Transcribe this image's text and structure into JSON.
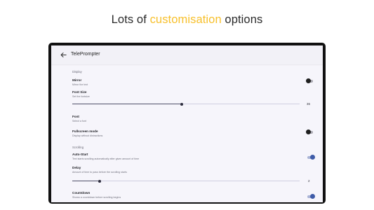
{
  "headline": {
    "prefix": "Lots of ",
    "highlight": "customisation",
    "suffix": " options",
    "highlight_color": "#f7c02c"
  },
  "app": {
    "title": "TelePrompter",
    "back_icon": "arrow-left-icon"
  },
  "sections": {
    "display": "Display",
    "scrolling": "Scrolling"
  },
  "settings": {
    "mirror": {
      "title": "Mirror",
      "subtitle": "Mirror the text",
      "enabled": false
    },
    "font_size": {
      "title": "Font Size",
      "subtitle": "Set the fontsize",
      "value": "36",
      "fraction": 0.48
    },
    "font": {
      "title": "Font",
      "subtitle": "Select a font"
    },
    "fullscreen": {
      "title": "Fullscreen mode",
      "subtitle": "Display without distractions",
      "enabled": false
    },
    "auto_start": {
      "title": "Auto-Start",
      "subtitle": "Text starts scrolling automatically after given amount of time",
      "enabled": true
    },
    "delay": {
      "title": "Delay",
      "subtitle": "Amount of time to pass before the scrolling starts",
      "value": "2",
      "fraction": 0.12
    },
    "countdown": {
      "title": "Countdown",
      "subtitle": "Shows a countdown before scrolling begins",
      "enabled": true
    }
  },
  "colors": {
    "accent_toggle": "#3f5ca8",
    "screen_background": "#f6f5fb"
  }
}
